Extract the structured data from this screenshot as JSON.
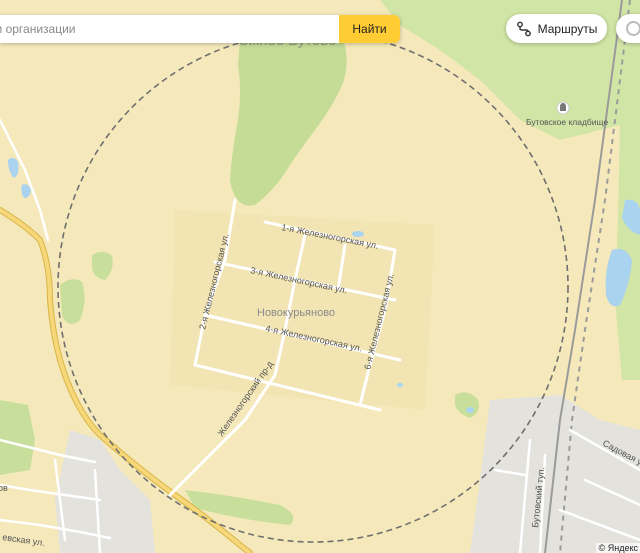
{
  "search": {
    "placeholder": "м организации",
    "button_label": "Найти"
  },
  "routes": {
    "label": "Маршруты"
  },
  "map": {
    "district_label": "Южное Бутово",
    "place_label": "Новокурьяново",
    "poi_cemetery": "Бутовское кладбище",
    "streets": {
      "zheleznogorskaya_1": "1-я Железногорская ул.",
      "zheleznogorskaya_2": "2-я Железногорская ул.",
      "zheleznogorskaya_3": "3-я Железногорская ул.",
      "zheleznogorskaya_4": "4-я Железногорская ул.",
      "zheleznogorskaya_6": "6-я Железногорская ул.",
      "zheleznogorsky_pr": "Железногорский пр-д",
      "sadovaya": "Садовая ул.",
      "butovsky_tup": "Бутовский туп.",
      "partial_left_1": "ов",
      "partial_left_2": "евская ул."
    },
    "copyright": "© Яндекс"
  },
  "colors": {
    "land": "#f5e9bb",
    "forest": "#d1e5a6",
    "road": "#ffffff",
    "highway": "#f6d77a",
    "water": "#a9d3ef",
    "industrial": "#e5e4e1",
    "search_button": "#ffcc33"
  }
}
